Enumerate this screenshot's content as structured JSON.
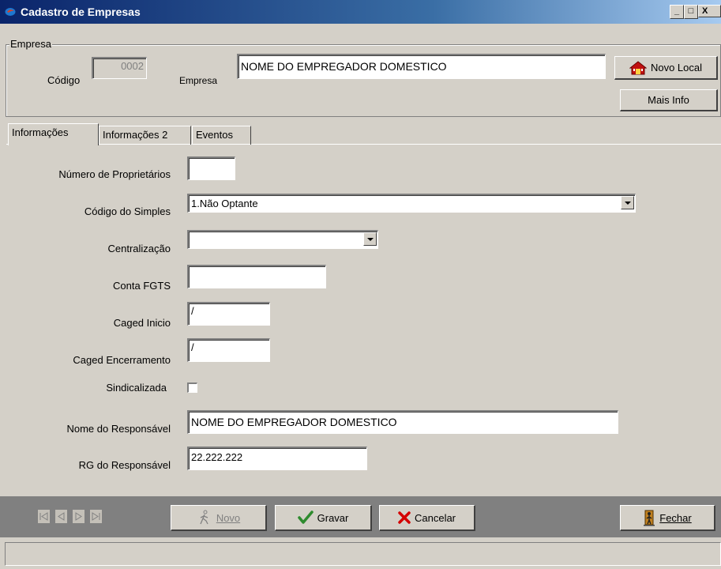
{
  "window": {
    "title": "Cadastro de Empresas",
    "controls": {
      "minimize": "_",
      "maximize": "□",
      "close": "X"
    }
  },
  "empresa_group": {
    "legend": "Empresa",
    "codigo_label": "Código",
    "codigo_value": "0002",
    "empresa_label": "Empresa",
    "empresa_value": "NOME DO EMPREGADOR DOMESTICO",
    "novo_local_label": "Novo Local",
    "mais_info_label": "Mais Info"
  },
  "tabs": [
    {
      "label": "Informações",
      "active": true
    },
    {
      "label": "Informações 2",
      "active": false
    },
    {
      "label": "Eventos",
      "active": false
    }
  ],
  "form": {
    "num_proprietarios": {
      "label": "Número de Proprietários",
      "value": ""
    },
    "codigo_simples": {
      "label": "Código do Simples",
      "value": "1.Não Optante"
    },
    "centralizacao": {
      "label": "Centralização",
      "value": ""
    },
    "conta_fgts": {
      "label": "Conta FGTS",
      "value": ""
    },
    "caged_inicio": {
      "label": "Caged Inicio",
      "value": "/"
    },
    "caged_encerramento": {
      "label": "Caged Encerramento",
      "value": "/"
    },
    "sindicalizada": {
      "label": "Sindicalizada",
      "checked": false
    },
    "nome_responsavel": {
      "label": "Nome do Responsável",
      "value": "NOME DO EMPREGADOR DOMESTICO"
    },
    "rg_responsavel": {
      "label": "RG do Responsável",
      "value": "22.222.222"
    }
  },
  "toolbar": {
    "novo_label": "Novo",
    "gravar_label": "Gravar",
    "cancelar_label": "Cancelar",
    "fechar_label": "Fechar"
  },
  "colors": {
    "face": "#d4d0c8",
    "title_start": "#0a246a",
    "title_end": "#a6caf0",
    "toolbar_bg": "#808080",
    "check_green": "#2e8b2e",
    "cancel_red": "#d40000"
  }
}
